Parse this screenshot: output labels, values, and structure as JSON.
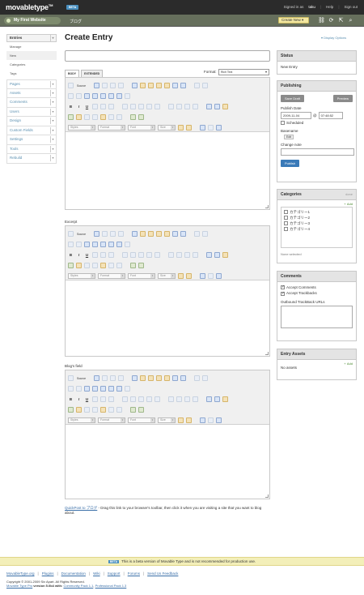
{
  "header": {
    "logo": "movabletype",
    "logo_tm": "TM",
    "beta_badge": "BETA",
    "signed_in_as": "Signed in as",
    "username": "taku",
    "help": "Help",
    "sign_out": "Sign out"
  },
  "blogbar": {
    "blog_name": "My First Website",
    "blog_subname": "ブログ",
    "create_new": "Create New ▾"
  },
  "sidebar": {
    "section_label": "Entries",
    "sub_items": [
      "Manage",
      "New",
      "Categories",
      "Tags"
    ],
    "items": [
      "Pages",
      "Assets",
      "Comments",
      "Users",
      "Design",
      "Custom Fields",
      "Settings",
      "Tools",
      "Rebuild"
    ]
  },
  "main": {
    "title": "Create Entry",
    "display_options": "▾ Display Options",
    "tabs": [
      "BODY",
      "EXTENDED"
    ],
    "format_label": "Format:",
    "format_value": "Rich Text",
    "excerpt_label": "Excerpt",
    "custom_field_label": "Blog's field",
    "toolbar": {
      "source": "Source",
      "bold": "B",
      "italic": "I",
      "underline": "U",
      "styles": "Styles",
      "format": "Format",
      "font": "Font",
      "size": "Size"
    }
  },
  "status_widget": {
    "title": "Status",
    "value": "New Entry"
  },
  "publishing_widget": {
    "title": "Publishing",
    "save_draft": "Save Draft",
    "preview": "Preview",
    "publish_date_label": "Publish Date",
    "date": "2009-11-04",
    "at": "@",
    "time": "07:48:52",
    "scheduled": "Scheduled",
    "basename_label": "Basename",
    "basename_edit": "Edit",
    "change_note_label": "Change note",
    "publish": "Publish"
  },
  "categories_widget": {
    "title": "Categories",
    "done": "done",
    "add": "Add",
    "items": [
      "カテゴリー1",
      "カテゴリー2",
      "カテゴリー3",
      "カテゴリー4"
    ],
    "none_selected": "None selected"
  },
  "comments_widget": {
    "title": "Comments",
    "accept_comments": "Accept Comments",
    "accept_trackbacks": "Accept Trackbacks",
    "outbound_label": "Outbound TrackBack URLs"
  },
  "assets_widget": {
    "title": "Entry Assets",
    "add": "Add",
    "empty": "No assets"
  },
  "quickpost": {
    "link": "QuickPost to ブログ",
    "text": " - Drag this link to your browser's toolbar, then click it when you are visiting a site that you want to blog about."
  },
  "beta_bar": {
    "tag": "BETA",
    "text": "This is a beta version of Movable Type and is not recommended for production use."
  },
  "footer": {
    "links": [
      "MovableType.org",
      "Plugins",
      "Documentation",
      "Wiki",
      "Support",
      "Forums",
      "Send Us Feedback"
    ],
    "copyright": "Copyright © 2001-2009 Six Apart. All Rights Reserved.",
    "version_prefix": "Movable Type Pro",
    "version_text": "version 5.0b4 with:",
    "pack1": "Community Pack 1.1",
    "pack2": "Professional Pack 1.3"
  },
  "colors": {
    "topbar": "#2b2b2b",
    "blogbar": "#666f5c",
    "link": "#3a6fa8",
    "publish": "#3a7ab8",
    "beta_bar": "#f3efb9"
  }
}
